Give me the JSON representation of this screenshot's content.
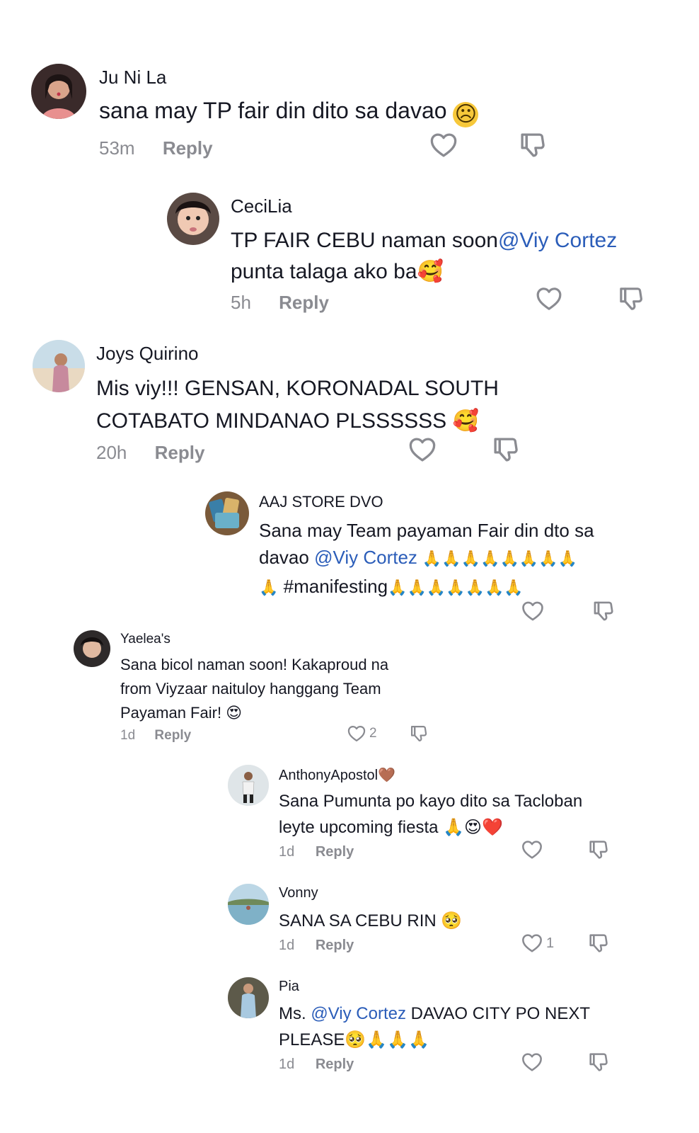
{
  "colors": {
    "mention": "#2b5db9",
    "muted": "#8a8b91",
    "text": "#161823"
  },
  "icons": {
    "like": "heart-outline-icon",
    "dislike": "thumbs-down-icon"
  },
  "reply_label": "Reply",
  "comments": [
    {
      "name": "Ju Ni La",
      "text_parts": [
        "sana may TP fair din dito sa davao ",
        "☹"
      ],
      "time": "53m"
    },
    {
      "name": "CeciLia",
      "line1": "TP FAIR CEBU naman soon",
      "mention": "@Viy Cortez",
      "line2": "punta talaga ako ba",
      "emoji": "🥰",
      "time": "5h"
    },
    {
      "name": "Joys Quirino",
      "line1": "Mis viy!!! GENSAN, KORONADAL SOUTH",
      "line2": "COTABATO MINDANAO PLSSSSSS ",
      "emoji": "🥰",
      "time": "20h"
    },
    {
      "name": "AAJ STORE DVO",
      "line1": "Sana may Team payaman Fair din dto sa",
      "line2_pre": "davao ",
      "mention": "@Viy Cortez",
      "line2_emoji": " 🙏🙏🙏🙏🙏🙏🙏🙏",
      "line3_emoji_pre": "🙏",
      "line3_text": " #manifesting",
      "line3_emoji": "🙏🙏🙏🙏🙏🙏🙏"
    },
    {
      "name": "Yaelea's",
      "line1": "Sana bicol naman soon! Kakaproud na",
      "line2": "from Viyzaar naituloy hanggang Team",
      "line3": "Payaman Fair! ",
      "emoji": "😍",
      "time": "1d",
      "likes": "2"
    },
    {
      "name": "AnthonyApostol",
      "name_emoji": "🤎",
      "line1": "Sana Pumunta po kayo dito sa Tacloban",
      "line2": "leyte upcoming fiesta ",
      "emoji": "🙏😍❤️",
      "time": "1d"
    },
    {
      "name": "Vonny",
      "line1": "SANA SA CEBU RIN ",
      "emoji": "🥺",
      "time": "1d",
      "likes": "1"
    },
    {
      "name": "Pia",
      "line1_pre": "Ms. ",
      "mention": "@Viy Cortez",
      "line1_post": " DAVAO CITY PO NEXT",
      "line2": "PLEASE",
      "emoji": "🥺🙏🙏🙏",
      "time": "1d"
    }
  ]
}
